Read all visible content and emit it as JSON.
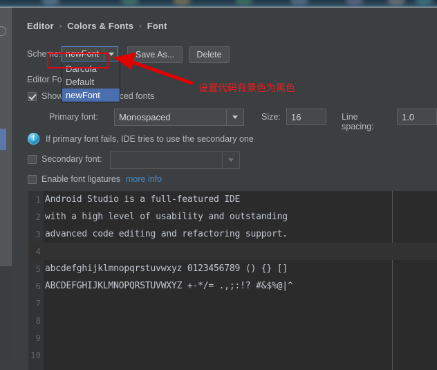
{
  "window": {
    "breadcrumb": [
      "Editor",
      "Colors & Fonts",
      "Font"
    ],
    "breadcrumb_separator": "›"
  },
  "colors": {
    "dialog_background": "#3c3f41",
    "editor_background": "#2b2b2b",
    "gutter_background": "#313335",
    "selection_blue": "#4b6eaf",
    "focus_border_blue": "#5a8fd6",
    "annotation_red": "#e60000",
    "link_blue": "#4a88c7",
    "text_primary": "#b3b8bb",
    "rail_selection": "#5c78ab"
  },
  "scheme_row": {
    "label": "Scheme:",
    "selected": "newFont",
    "dropdown_icon": "chevron-down-icon",
    "save_as_button": "Save As...",
    "delete_button": "Delete"
  },
  "scheme_dropdown": {
    "open": true,
    "options": [
      "Darcula",
      "Default",
      "newFont"
    ],
    "selected_index": 2
  },
  "editor_font": {
    "section_title": "Editor Font",
    "show_monospaced": {
      "label": "Show only monospaced fonts",
      "checked": true
    },
    "primary_font": {
      "label": "Primary font:",
      "value": "Monospaced",
      "dropdown_icon": "chevron-down-icon"
    },
    "size": {
      "label": "Size:",
      "value": "16"
    },
    "line_spacing": {
      "label": "Line spacing:",
      "value": "1.0"
    },
    "info": {
      "icon": "info-exclamation-icon",
      "text": "If primary font fails, IDE tries to use the secondary one"
    },
    "secondary_font": {
      "label": "Secondary font:",
      "checked": false,
      "value": "",
      "dropdown_icon": "chevron-down-icon"
    },
    "ligatures": {
      "label": "Enable font ligatures",
      "checked": false,
      "link": "more info"
    }
  },
  "annotations": {
    "highlight_target": "Darcula",
    "arrow": "red-arrow-icon",
    "note_text": "设置代码背景色为黑色"
  },
  "preview": {
    "lines": [
      {
        "num": "1",
        "text": "Android Studio is a full-featured IDE",
        "caret": false
      },
      {
        "num": "2",
        "text": "with a high level of usability and outstanding",
        "caret": false
      },
      {
        "num": "3",
        "text": "advanced code editing and refactoring support.",
        "caret": false
      },
      {
        "num": "4",
        "text": "",
        "caret": true
      },
      {
        "num": "5",
        "text": "abcdefghijklmnopqrstuvwxyz 0123456789 () {} []",
        "caret": false
      },
      {
        "num": "6",
        "text": "ABCDEFGHIJKLMNOPQRSTUVWXYZ +-*/= .,;:!? #&$%@|^",
        "caret": false
      },
      {
        "num": "7",
        "text": "",
        "caret": false
      },
      {
        "num": "8",
        "text": "",
        "caret": false
      },
      {
        "num": "9",
        "text": "",
        "caret": false
      },
      {
        "num": "10",
        "text": "",
        "caret": false
      }
    ]
  }
}
